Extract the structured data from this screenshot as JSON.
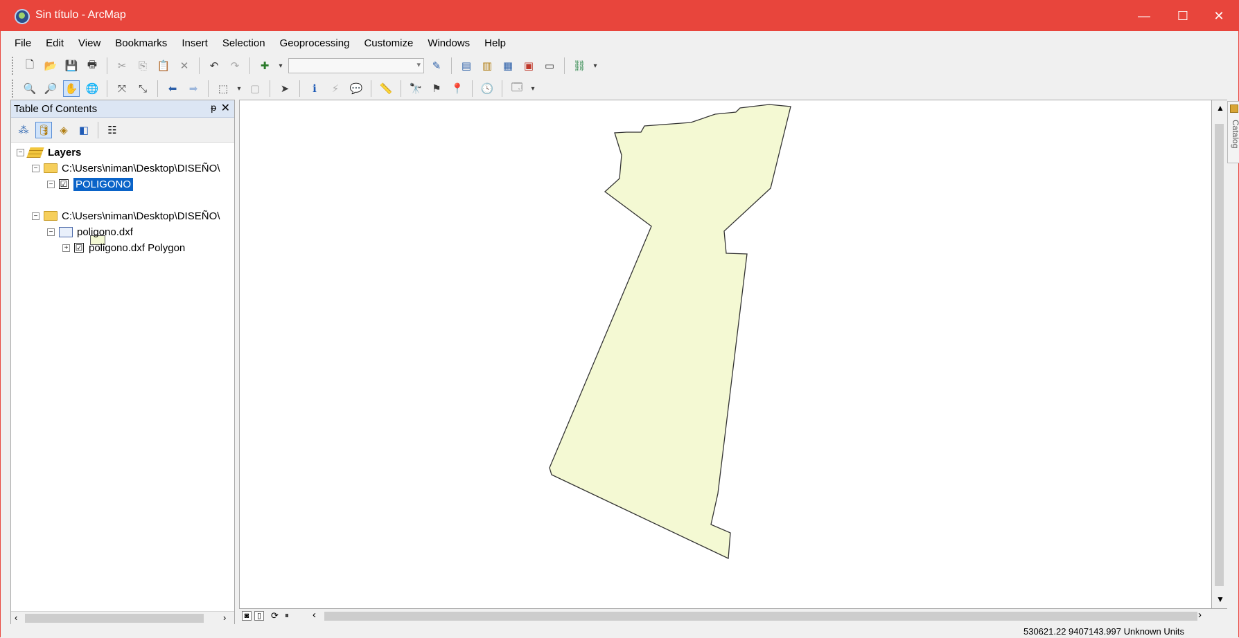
{
  "window": {
    "title": "Sin título - ArcMap",
    "controls": {
      "minimize": "—",
      "maximize": "☐",
      "close": "✕"
    },
    "accent_color": "#e8453c"
  },
  "menu": [
    "File",
    "Edit",
    "View",
    "Bookmarks",
    "Insert",
    "Selection",
    "Geoprocessing",
    "Customize",
    "Windows",
    "Help"
  ],
  "toolbar_standard": {
    "icons": [
      "new-document-icon",
      "open-folder-icon",
      "save-icon",
      "print-icon",
      "cut-icon",
      "copy-icon",
      "paste-icon",
      "delete-icon",
      "undo-icon",
      "redo-icon",
      "add-data-icon",
      "scale-combo",
      "editor-icon",
      "table-of-contents-icon",
      "catalog-icon",
      "search-window-icon",
      "arctoolbox-icon",
      "python-window-icon",
      "model-builder-icon"
    ],
    "scale_value": ""
  },
  "toolbar_tools": {
    "icons": [
      "zoom-in-icon",
      "zoom-out-icon",
      "pan-icon",
      "full-extent-icon",
      "fixed-zoom-in-icon",
      "fixed-zoom-out-icon",
      "back-extent-icon",
      "forward-extent-icon",
      "select-features-icon",
      "clear-selection-icon",
      "select-elements-icon",
      "identify-icon",
      "hyperlink-icon",
      "html-popup-icon",
      "measure-icon",
      "find-icon",
      "find-route-icon",
      "go-to-xy-icon",
      "time-slider-icon",
      "create-viewer-icon"
    ]
  },
  "toc": {
    "title": "Table Of Contents",
    "pin": "ᵽ",
    "close": "✕",
    "tree": {
      "root": "Layers",
      "folder1": "C:\\Users\\niman\\Desktop\\DISEÑO\\",
      "layer1": "POLIGONO",
      "folder2": "C:\\Users\\niman\\Desktop\\DISEÑO\\",
      "dataset": "poligono.dxf",
      "layer2": "poligono.dxf Polygon"
    },
    "layer_checked": [
      "☑",
      "☑"
    ]
  },
  "map": {
    "polygon_fill": "#f4f9d3",
    "polygon_stroke": "#333333"
  },
  "catalog_tab": {
    "label": "Catalog"
  },
  "status": {
    "coordinates": "530621.22  9407143.997 Unknown Units"
  }
}
